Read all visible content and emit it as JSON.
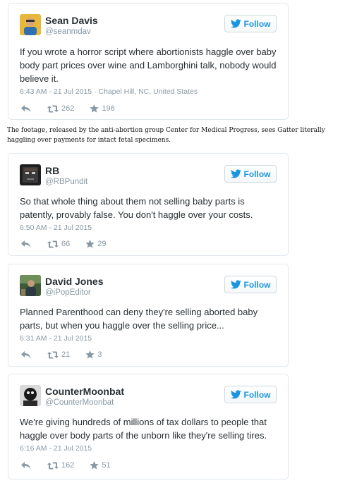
{
  "follow_label": "Follow",
  "colors": {
    "accent": "#1b95e0",
    "border": "#e1e8ed",
    "muted": "#8899a6",
    "text": "#292f33"
  },
  "icons": {
    "reply": "reply-icon",
    "retweet": "retweet-icon",
    "favorite": "star-icon",
    "follow": "twitter-bird-icon"
  },
  "caption": "The footage, released by the anti-abortion group Center for Medical Progress, sees Gatter literally haggling over payments for intact fetal specimens.",
  "tweets": [
    {
      "name": "Sean Davis",
      "handle": "@seanmdav",
      "text": "If you wrote a horror script where abortionists haggle over baby body part prices over wine and Lamborghini talk, nobody would believe it.",
      "meta": "6:43 AM - 21 Jul 2015 · Chapel Hill, NC, United States",
      "retweets": "262",
      "favorites": "196"
    },
    {
      "name": "RB",
      "handle": "@RBPundit",
      "text": "So that whole thing about them not selling baby parts is patently, provably false. You don't haggle over your costs.",
      "meta": "6:50 AM - 21 Jul 2015",
      "retweets": "66",
      "favorites": "29"
    },
    {
      "name": "David Jones",
      "handle": "@iPopEditor",
      "text": "Planned Parenthood can deny they're selling aborted baby parts, but when you haggle over the selling price...",
      "meta": "6:31 AM - 21 Jul 2015",
      "retweets": "21",
      "favorites": "3"
    },
    {
      "name": "CounterMoonbat",
      "handle": "@CounterMoonbat",
      "text": "We're giving hundreds of millions of tax dollars to people that haggle over body parts of the unborn like they're selling tires.",
      "meta": "6:16 AM - 21 Jul 2015",
      "retweets": "162",
      "favorites": "51"
    }
  ]
}
